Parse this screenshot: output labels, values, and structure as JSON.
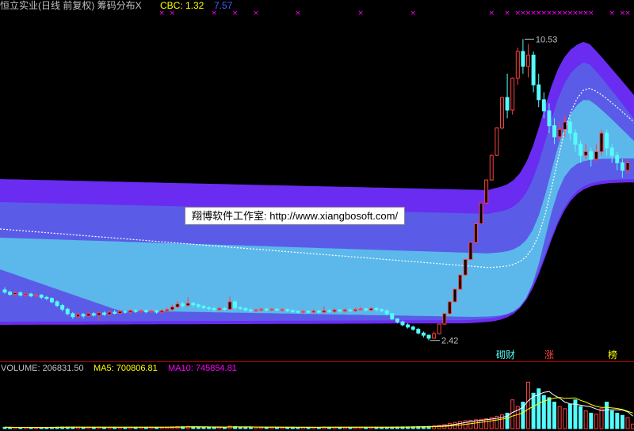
{
  "header": {
    "title": "恒立实业(日线 前复权) 筹码分布X",
    "cbc_label": "CBC: 1.32",
    "cbc_value2": "7.57"
  },
  "watermark": "翔博软件工作室: http://www.xiangbosoft.com/",
  "annotations": {
    "high_label": "10.53",
    "low_label": "2.42",
    "tags": [
      "砌财",
      "涨",
      "榜"
    ]
  },
  "volume_header": {
    "volume": "VOLUME: 206831.50",
    "ma5": "MA5: 700806.81",
    "ma10": "MA10: 745854.81"
  },
  "colors": {
    "up": "#ff4040",
    "down": "#54fcfc",
    "band_outer": "#6a2cf0",
    "band_mid": "#5a5ce8",
    "band_inner": "#5cb8ea",
    "ma_line": "#ffffff",
    "marker": "#ff00ff",
    "text_main": "#c0c0c0",
    "text_cbc": "#ffff00",
    "text_blue": "#4060ff",
    "ma5_color": "#ffff00",
    "ma10_color": "#ff00ff"
  },
  "chart_data": {
    "type": "candlestick",
    "price_range": [
      2.2,
      11.2
    ],
    "high": 10.53,
    "low": 2.42,
    "candles": [
      {
        "o": 3.78,
        "c": 3.72,
        "h": 3.85,
        "l": 3.68
      },
      {
        "o": 3.72,
        "c": 3.66,
        "h": 3.76,
        "l": 3.62
      },
      {
        "o": 3.66,
        "c": 3.7,
        "h": 3.74,
        "l": 3.62
      },
      {
        "o": 3.7,
        "c": 3.64,
        "h": 3.74,
        "l": 3.6
      },
      {
        "o": 3.64,
        "c": 3.67,
        "h": 3.71,
        "l": 3.6
      },
      {
        "o": 3.67,
        "c": 3.62,
        "h": 3.7,
        "l": 3.58
      },
      {
        "o": 3.62,
        "c": 3.64,
        "h": 3.68,
        "l": 3.58
      },
      {
        "o": 3.64,
        "c": 3.58,
        "h": 3.67,
        "l": 3.54
      },
      {
        "o": 3.58,
        "c": 3.55,
        "h": 3.62,
        "l": 3.5
      },
      {
        "o": 3.55,
        "c": 3.46,
        "h": 3.58,
        "l": 3.42
      },
      {
        "o": 3.46,
        "c": 3.36,
        "h": 3.5,
        "l": 3.32
      },
      {
        "o": 3.36,
        "c": 3.26,
        "h": 3.4,
        "l": 3.2
      },
      {
        "o": 3.26,
        "c": 3.14,
        "h": 3.3,
        "l": 3.1
      },
      {
        "o": 3.14,
        "c": 3.06,
        "h": 3.18,
        "l": 3.0
      },
      {
        "o": 3.06,
        "c": 3.12,
        "h": 3.18,
        "l": 3.02
      },
      {
        "o": 3.12,
        "c": 3.08,
        "h": 3.16,
        "l": 3.02
      },
      {
        "o": 3.08,
        "c": 3.14,
        "h": 3.2,
        "l": 3.04
      },
      {
        "o": 3.14,
        "c": 3.1,
        "h": 3.18,
        "l": 3.06
      },
      {
        "o": 3.1,
        "c": 3.16,
        "h": 3.2,
        "l": 2.96
      },
      {
        "o": 3.16,
        "c": 3.12,
        "h": 3.2,
        "l": 3.08
      },
      {
        "o": 3.12,
        "c": 3.18,
        "h": 3.22,
        "l": 3.08
      },
      {
        "o": 3.18,
        "c": 3.15,
        "h": 3.24,
        "l": 3.12
      },
      {
        "o": 3.15,
        "c": 3.2,
        "h": 3.24,
        "l": 3.12
      },
      {
        "o": 3.2,
        "c": 3.18,
        "h": 3.24,
        "l": 3.14
      },
      {
        "o": 3.18,
        "c": 3.22,
        "h": 3.26,
        "l": 3.14
      },
      {
        "o": 3.22,
        "c": 3.2,
        "h": 3.26,
        "l": 3.16
      },
      {
        "o": 3.2,
        "c": 3.22,
        "h": 3.26,
        "l": 3.16
      },
      {
        "o": 3.22,
        "c": 3.19,
        "h": 3.25,
        "l": 3.15
      },
      {
        "o": 3.19,
        "c": 3.21,
        "h": 3.25,
        "l": 3.16
      },
      {
        "o": 3.21,
        "c": 3.18,
        "h": 3.24,
        "l": 3.14
      },
      {
        "o": 3.18,
        "c": 3.22,
        "h": 3.26,
        "l": 3.14
      },
      {
        "o": 3.22,
        "c": 3.25,
        "h": 3.3,
        "l": 3.18
      },
      {
        "o": 3.25,
        "c": 3.32,
        "h": 3.38,
        "l": 3.22
      },
      {
        "o": 3.32,
        "c": 3.4,
        "h": 3.48,
        "l": 3.28
      },
      {
        "o": 3.4,
        "c": 3.36,
        "h": 3.46,
        "l": 3.3
      },
      {
        "o": 3.36,
        "c": 3.42,
        "h": 3.58,
        "l": 3.32
      },
      {
        "o": 3.42,
        "c": 3.38,
        "h": 3.46,
        "l": 3.32
      },
      {
        "o": 3.38,
        "c": 3.34,
        "h": 3.42,
        "l": 3.28
      },
      {
        "o": 3.34,
        "c": 3.3,
        "h": 3.38,
        "l": 3.26
      },
      {
        "o": 3.3,
        "c": 3.28,
        "h": 3.34,
        "l": 3.22
      },
      {
        "o": 3.28,
        "c": 3.25,
        "h": 3.32,
        "l": 3.2
      },
      {
        "o": 3.25,
        "c": 3.28,
        "h": 3.32,
        "l": 3.2
      },
      {
        "o": 3.28,
        "c": 3.26,
        "h": 3.32,
        "l": 3.22
      },
      {
        "o": 3.26,
        "c": 3.46,
        "h": 3.6,
        "l": 3.24
      },
      {
        "o": 3.46,
        "c": 3.3,
        "h": 3.5,
        "l": 3.26
      },
      {
        "o": 3.3,
        "c": 3.28,
        "h": 3.34,
        "l": 3.24
      },
      {
        "o": 3.28,
        "c": 3.24,
        "h": 3.32,
        "l": 3.2
      },
      {
        "o": 3.24,
        "c": 3.22,
        "h": 3.28,
        "l": 3.18
      },
      {
        "o": 3.22,
        "c": 3.24,
        "h": 3.28,
        "l": 3.18
      },
      {
        "o": 3.24,
        "c": 3.26,
        "h": 3.3,
        "l": 3.2
      },
      {
        "o": 3.26,
        "c": 3.24,
        "h": 3.3,
        "l": 3.2
      },
      {
        "o": 3.24,
        "c": 3.26,
        "h": 3.3,
        "l": 3.21
      },
      {
        "o": 3.26,
        "c": 3.24,
        "h": 3.29,
        "l": 3.2
      },
      {
        "o": 3.24,
        "c": 3.25,
        "h": 3.29,
        "l": 3.2
      },
      {
        "o": 3.25,
        "c": 3.22,
        "h": 3.28,
        "l": 3.18
      },
      {
        "o": 3.22,
        "c": 3.2,
        "h": 3.26,
        "l": 3.16
      },
      {
        "o": 3.2,
        "c": 3.18,
        "h": 3.24,
        "l": 3.14
      },
      {
        "o": 3.18,
        "c": 3.2,
        "h": 3.24,
        "l": 3.14
      },
      {
        "o": 3.2,
        "c": 3.18,
        "h": 3.24,
        "l": 3.14
      },
      {
        "o": 3.18,
        "c": 3.21,
        "h": 3.26,
        "l": 3.14
      },
      {
        "o": 3.21,
        "c": 3.18,
        "h": 3.25,
        "l": 3.14
      },
      {
        "o": 3.18,
        "c": 3.22,
        "h": 3.34,
        "l": 3.14
      },
      {
        "o": 3.22,
        "c": 3.2,
        "h": 3.26,
        "l": 3.16
      },
      {
        "o": 3.2,
        "c": 3.24,
        "h": 3.28,
        "l": 3.16
      },
      {
        "o": 3.24,
        "c": 3.21,
        "h": 3.27,
        "l": 3.17
      },
      {
        "o": 3.21,
        "c": 3.24,
        "h": 3.28,
        "l": 3.17
      },
      {
        "o": 3.24,
        "c": 3.22,
        "h": 3.28,
        "l": 3.18
      },
      {
        "o": 3.22,
        "c": 3.25,
        "h": 3.3,
        "l": 3.18
      },
      {
        "o": 3.25,
        "c": 3.27,
        "h": 3.32,
        "l": 3.22
      },
      {
        "o": 3.27,
        "c": 3.24,
        "h": 3.3,
        "l": 3.2
      },
      {
        "o": 3.24,
        "c": 3.28,
        "h": 3.32,
        "l": 3.2
      },
      {
        "o": 3.28,
        "c": 3.25,
        "h": 3.32,
        "l": 3.2
      },
      {
        "o": 3.25,
        "c": 3.22,
        "h": 3.29,
        "l": 3.18
      },
      {
        "o": 3.22,
        "c": 3.14,
        "h": 3.25,
        "l": 3.1
      },
      {
        "o": 3.14,
        "c": 3.0,
        "h": 3.16,
        "l": 2.96
      },
      {
        "o": 3.0,
        "c": 2.92,
        "h": 3.02,
        "l": 2.88
      },
      {
        "o": 2.92,
        "c": 2.84,
        "h": 2.95,
        "l": 2.8
      },
      {
        "o": 2.84,
        "c": 2.78,
        "h": 2.88,
        "l": 2.74
      },
      {
        "o": 2.78,
        "c": 2.72,
        "h": 2.82,
        "l": 2.68
      },
      {
        "o": 2.72,
        "c": 2.62,
        "h": 2.76,
        "l": 2.58
      },
      {
        "o": 2.62,
        "c": 2.56,
        "h": 2.66,
        "l": 2.5
      },
      {
        "o": 2.56,
        "c": 2.48,
        "h": 2.58,
        "l": 2.42
      },
      {
        "o": 2.48,
        "c": 2.6,
        "h": 2.66,
        "l": 2.46
      },
      {
        "o": 2.6,
        "c": 2.86,
        "h": 2.86,
        "l": 2.58
      },
      {
        "o": 2.86,
        "c": 3.14,
        "h": 3.14,
        "l": 2.84
      },
      {
        "o": 3.14,
        "c": 3.46,
        "h": 3.46,
        "l": 3.12
      },
      {
        "o": 3.46,
        "c": 3.8,
        "h": 3.8,
        "l": 3.44
      },
      {
        "o": 3.8,
        "c": 4.18,
        "h": 4.18,
        "l": 3.78
      },
      {
        "o": 4.18,
        "c": 4.6,
        "h": 4.6,
        "l": 4.16
      },
      {
        "o": 4.6,
        "c": 5.06,
        "h": 5.06,
        "l": 4.58
      },
      {
        "o": 5.06,
        "c": 5.56,
        "h": 5.56,
        "l": 5.04
      },
      {
        "o": 5.56,
        "c": 6.12,
        "h": 6.12,
        "l": 5.54
      },
      {
        "o": 6.12,
        "c": 6.74,
        "h": 6.74,
        "l": 6.1
      },
      {
        "o": 6.74,
        "c": 7.4,
        "h": 7.42,
        "l": 6.72
      },
      {
        "o": 7.4,
        "c": 8.14,
        "h": 8.16,
        "l": 7.38
      },
      {
        "o": 8.14,
        "c": 8.96,
        "h": 8.98,
        "l": 8.1
      },
      {
        "o": 8.96,
        "c": 8.62,
        "h": 9.6,
        "l": 8.4
      },
      {
        "o": 8.62,
        "c": 9.48,
        "h": 9.5,
        "l": 8.5
      },
      {
        "o": 9.48,
        "c": 10.2,
        "h": 10.3,
        "l": 9.3
      },
      {
        "o": 10.2,
        "c": 9.8,
        "h": 10.53,
        "l": 9.6
      },
      {
        "o": 9.8,
        "c": 10.1,
        "h": 10.4,
        "l": 9.5
      },
      {
        "o": 10.1,
        "c": 9.3,
        "h": 10.2,
        "l": 9.1
      },
      {
        "o": 9.3,
        "c": 8.9,
        "h": 9.6,
        "l": 8.7
      },
      {
        "o": 8.9,
        "c": 8.6,
        "h": 9.1,
        "l": 8.4
      },
      {
        "o": 8.6,
        "c": 8.2,
        "h": 8.8,
        "l": 8.0
      },
      {
        "o": 8.2,
        "c": 7.9,
        "h": 8.4,
        "l": 7.7
      },
      {
        "o": 7.9,
        "c": 8.1,
        "h": 8.3,
        "l": 7.8
      },
      {
        "o": 8.1,
        "c": 8.3,
        "h": 8.5,
        "l": 7.9
      },
      {
        "o": 8.3,
        "c": 8.0,
        "h": 8.4,
        "l": 7.8
      },
      {
        "o": 8.0,
        "c": 7.7,
        "h": 8.1,
        "l": 7.5
      },
      {
        "o": 7.7,
        "c": 7.4,
        "h": 7.8,
        "l": 7.2
      },
      {
        "o": 7.4,
        "c": 7.5,
        "h": 7.7,
        "l": 7.3
      },
      {
        "o": 7.5,
        "c": 7.3,
        "h": 7.6,
        "l": 7.1
      },
      {
        "o": 7.3,
        "c": 7.5,
        "h": 7.7,
        "l": 7.2
      },
      {
        "o": 7.5,
        "c": 8.0,
        "h": 8.1,
        "l": 7.4
      },
      {
        "o": 8.0,
        "c": 7.6,
        "h": 8.1,
        "l": 7.4
      },
      {
        "o": 7.6,
        "c": 7.4,
        "h": 7.7,
        "l": 7.2
      },
      {
        "o": 7.4,
        "c": 7.2,
        "h": 7.5,
        "l": 7.0
      },
      {
        "o": 7.2,
        "c": 7.0,
        "h": 7.3,
        "l": 6.8
      },
      {
        "o": 7.0,
        "c": 7.2,
        "h": 7.3,
        "l": 6.9
      }
    ],
    "volume_range": [
      0,
      2400000
    ],
    "volumes": [
      60000,
      55000,
      50000,
      52000,
      48000,
      50000,
      47000,
      52000,
      55000,
      60000,
      65000,
      70000,
      72000,
      68000,
      60000,
      58000,
      62000,
      60000,
      64000,
      58000,
      60000,
      62000,
      60000,
      58000,
      62000,
      60000,
      58000,
      60000,
      62000,
      58000,
      60000,
      64000,
      80000,
      90000,
      85000,
      100000,
      80000,
      70000,
      65000,
      62000,
      60000,
      62000,
      60000,
      110000,
      90000,
      70000,
      65000,
      62000,
      60000,
      62000,
      60000,
      62000,
      60000,
      61000,
      60000,
      58000,
      56000,
      58000,
      56000,
      58000,
      56000,
      70000,
      60000,
      62000,
      60000,
      62000,
      60000,
      62000,
      64000,
      62000,
      64000,
      62000,
      60000,
      62000,
      70000,
      75000,
      78000,
      80000,
      82000,
      90000,
      95000,
      100000,
      120000,
      150000,
      180000,
      240000,
      280000,
      320000,
      360000,
      380000,
      400000,
      420000,
      450000,
      500000,
      560000,
      620000,
      700000,
      1300000,
      1000000,
      1200000,
      2100000,
      1600000,
      1800000,
      1500000,
      1400000,
      1200000,
      1000000,
      900000,
      1100000,
      1300000,
      1000000,
      800000,
      700000,
      650000,
      900000,
      1200000,
      800000,
      700000,
      600000,
      500000,
      206831
    ]
  }
}
